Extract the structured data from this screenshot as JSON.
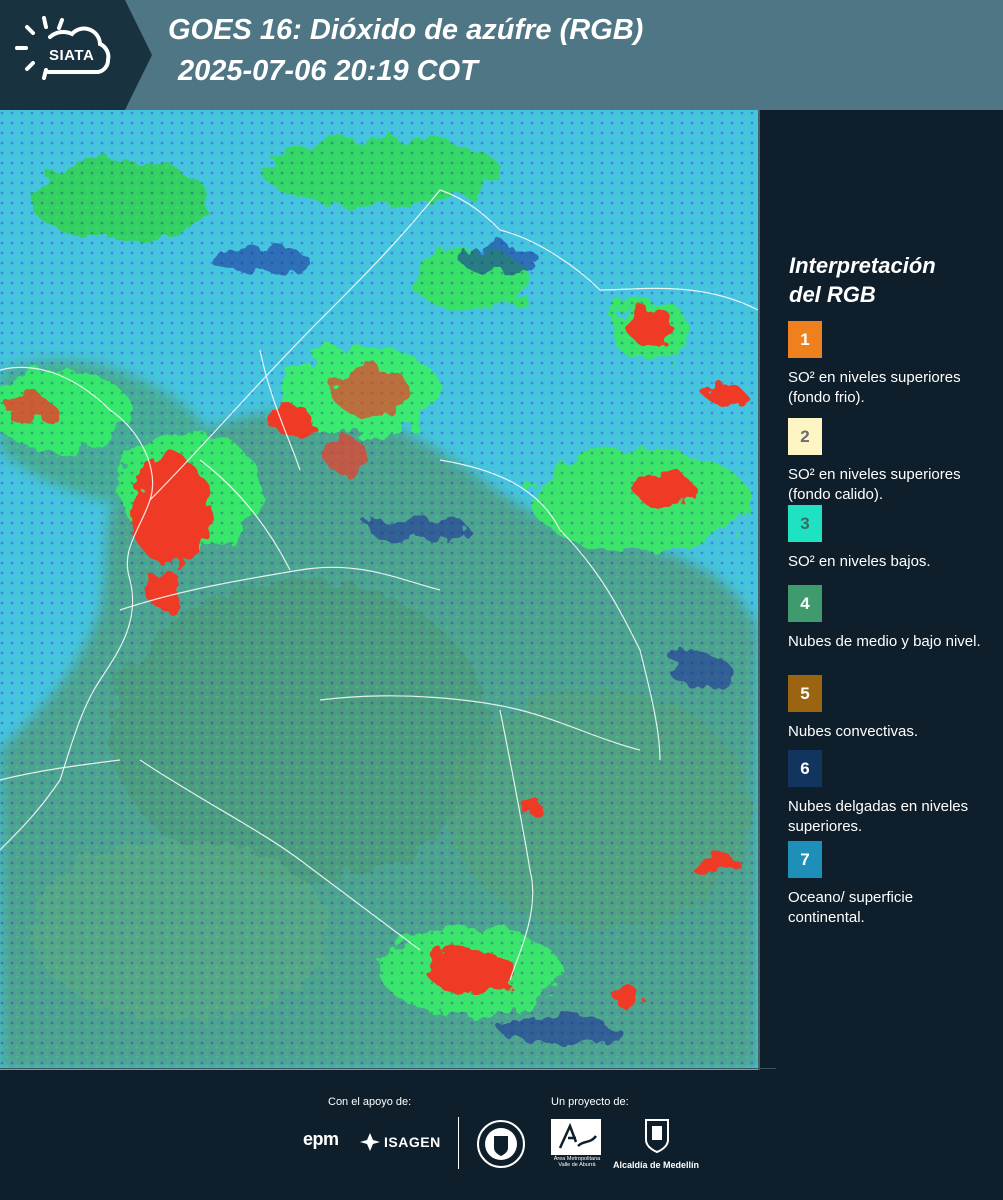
{
  "header": {
    "logo": "SIATA",
    "title": "GOES 16: Dióxido de azúfre (RGB)",
    "subtitle": "2025-07-06 20:19 COT"
  },
  "legend": {
    "title_line1": "Interpretación",
    "title_line2": "del RGB",
    "items": [
      {
        "number": "1",
        "label": "SO² en niveles superiores (fondo frio).",
        "color": "#f0801d"
      },
      {
        "number": "2",
        "label": "SO² en niveles superiores (fondo calido).",
        "color": "#fdf5c4"
      },
      {
        "number": "3",
        "label": "SO² en niveles bajos.",
        "color": "#1fe2c2"
      },
      {
        "number": "4",
        "label": "Nubes de medio y bajo nivel.",
        "color": "#3f9b6e"
      },
      {
        "number": "5",
        "label": "Nubes convectivas.",
        "color": "#9b6411"
      },
      {
        "number": "6",
        "label": "Nubes delgadas en niveles superiores.",
        "color": "#123560"
      },
      {
        "number": "7",
        "label": "Oceano/ superficie continental.",
        "color": "#1e8fb8"
      }
    ]
  },
  "footer": {
    "support_label": "Con el apoyo de:",
    "project_label": "Un proyecto de:",
    "sponsor1": "epm",
    "sponsor2": "ISAGEN",
    "partner1": "Área Metropolitana Valle de Aburrá",
    "partner2": "Alcaldía de Medellín"
  }
}
